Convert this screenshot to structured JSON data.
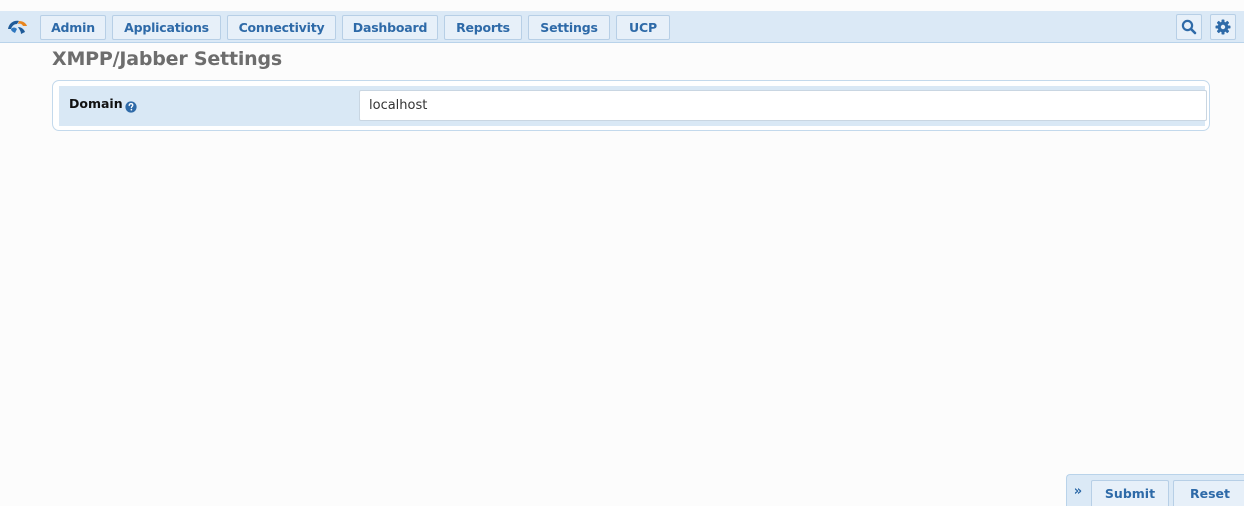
{
  "nav": {
    "logo_icon": "freepbx-logo-icon",
    "items": [
      {
        "label": "Admin"
      },
      {
        "label": "Applications"
      },
      {
        "label": "Connectivity"
      },
      {
        "label": "Dashboard"
      },
      {
        "label": "Reports"
      },
      {
        "label": "Settings"
      },
      {
        "label": "UCP"
      }
    ],
    "search_icon": "search-icon",
    "settings_icon": "gear-icon"
  },
  "page": {
    "title": "XMPP/Jabber Settings"
  },
  "form": {
    "domain_label": "Domain",
    "help_icon": "question-circle-icon",
    "domain_value": "localhost"
  },
  "actions": {
    "expand_label": "»",
    "submit_label": "Submit",
    "reset_label": "Reset"
  },
  "colors": {
    "nav_background": "#dbe9f6",
    "nav_text": "#2e6aa8",
    "label_background": "#d9e8f5",
    "title_text": "#6d6d6d",
    "help_icon": "#2e6aa8"
  }
}
